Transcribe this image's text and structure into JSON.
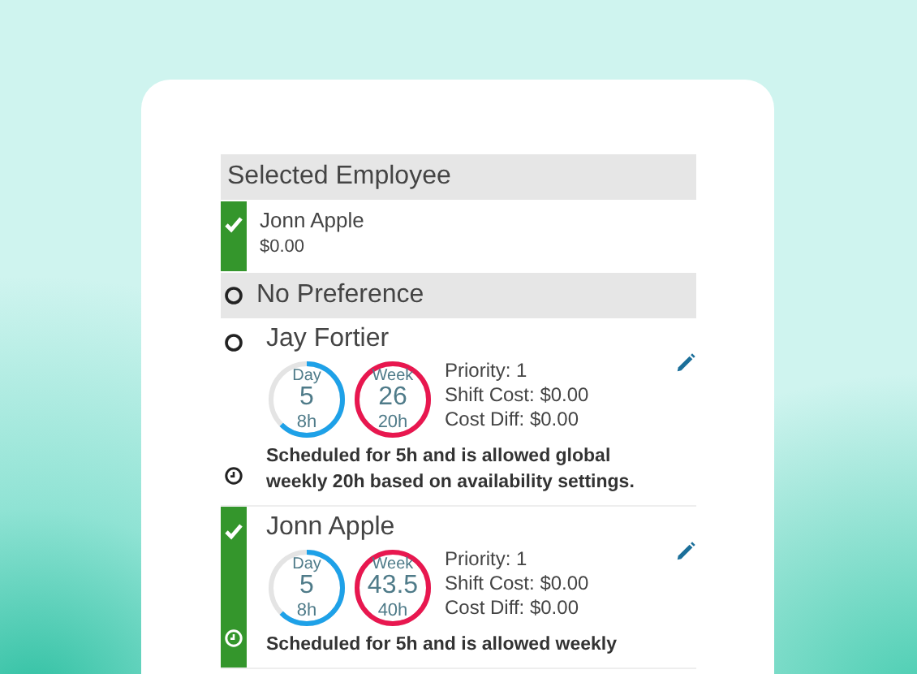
{
  "selected_section": {
    "title": "Selected Employee",
    "employee": {
      "name": "Jonn Apple",
      "cost": "$0.00",
      "selected": true
    }
  },
  "no_preference": {
    "label": "No Preference",
    "selected": false
  },
  "employees": [
    {
      "name": "Jay Fortier",
      "selected": false,
      "day": {
        "label": "Day",
        "value": "5",
        "cap": "8h",
        "level": 0.625
      },
      "week": {
        "label": "Week",
        "value": "26",
        "cap": "20h",
        "level": 1
      },
      "priority": "Priority: 1",
      "shift_cost": "Shift Cost: $0.00",
      "cost_diff": "Cost Diff: $0.00",
      "note": "Scheduled for 5h and is allowed global weekly 20h based on availability settings."
    },
    {
      "name": "Jonn Apple",
      "selected": true,
      "day": {
        "label": "Day",
        "value": "5",
        "cap": "8h",
        "level": 0.625
      },
      "week": {
        "label": "Week",
        "value": "43.5",
        "cap": "40h",
        "level": 1
      },
      "priority": "Priority: 1",
      "shift_cost": "Shift Cost: $0.00",
      "cost_diff": "Cost Diff: $0.00",
      "note": "Scheduled for 5h and is allowed weekly"
    }
  ]
}
